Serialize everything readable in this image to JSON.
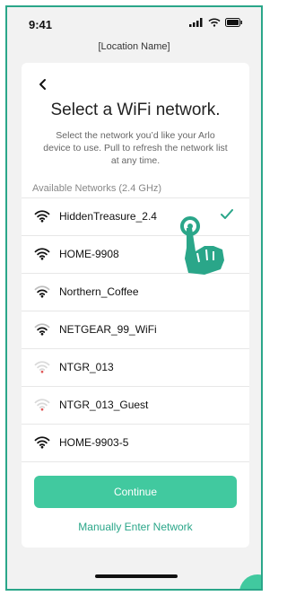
{
  "status": {
    "time": "9:41"
  },
  "header": {
    "location": "[Location Name]"
  },
  "page": {
    "title": "Select a WiFi network.",
    "description": "Select the network you’d like your Arlo device to use. Pull to refresh the network list at any time.",
    "section_label": "Available Networks (2.4 GHz)"
  },
  "networks": [
    {
      "name": "HiddenTreasure_2.4",
      "selected": true
    },
    {
      "name": "HOME-9908",
      "selected": false
    },
    {
      "name": "Northern_Coffee",
      "selected": false
    },
    {
      "name": "NETGEAR_99_WiFi",
      "selected": false
    },
    {
      "name": "NTGR_013",
      "selected": false
    },
    {
      "name": "NTGR_013_Guest",
      "selected": false
    },
    {
      "name": "HOME-9903-5",
      "selected": false
    }
  ],
  "actions": {
    "continue_label": "Continue",
    "manual_label": "Manually Enter Network"
  },
  "colors": {
    "accent": "#41c99f",
    "frame": "#2aa689"
  },
  "icons": {
    "back": "chevron-left-icon",
    "wifi": "wifi-icon",
    "check": "checkmark-icon",
    "hand": "tap-hand-icon"
  }
}
